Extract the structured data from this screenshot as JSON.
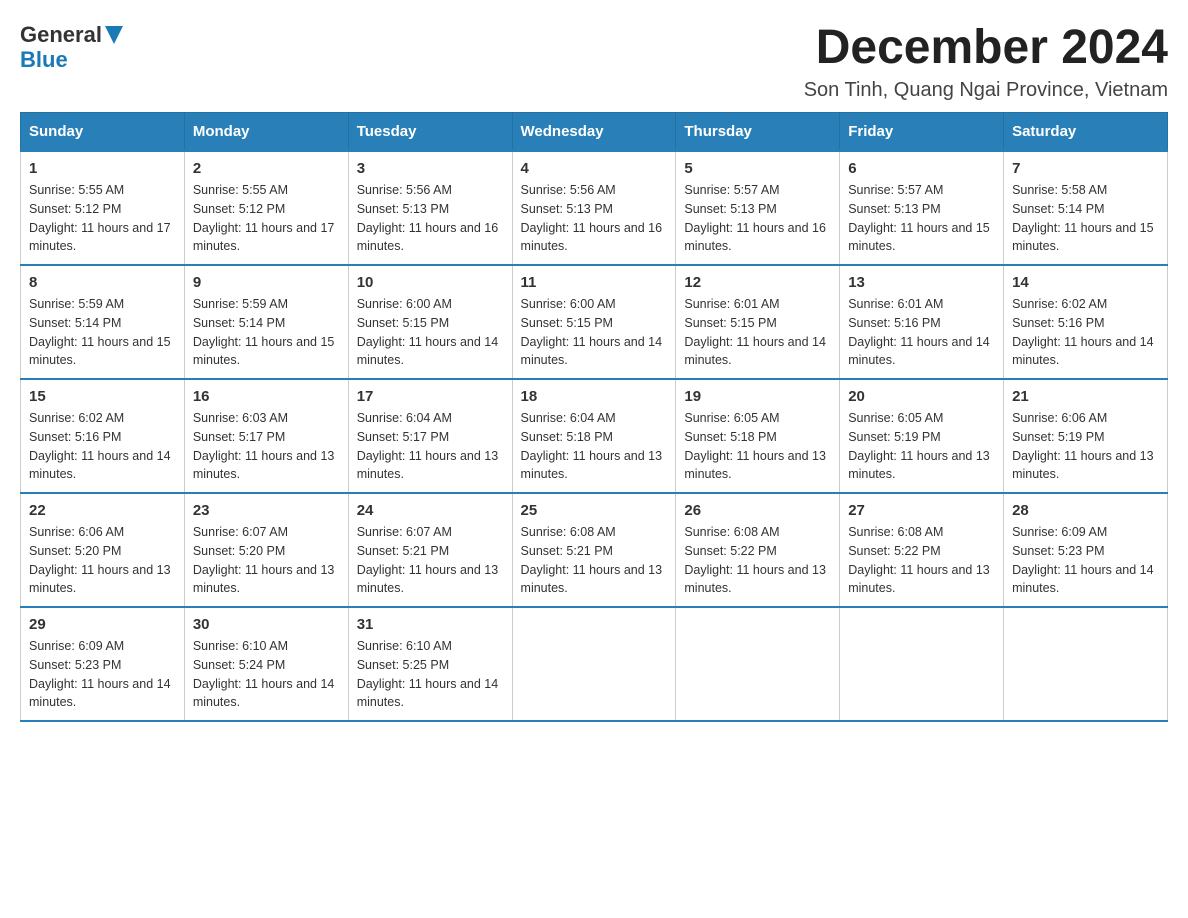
{
  "header": {
    "logo_general": "General",
    "logo_blue": "Blue",
    "month_title": "December 2024",
    "location": "Son Tinh, Quang Ngai Province, Vietnam"
  },
  "days_of_week": [
    "Sunday",
    "Monday",
    "Tuesday",
    "Wednesday",
    "Thursday",
    "Friday",
    "Saturday"
  ],
  "weeks": [
    [
      {
        "day": "1",
        "sunrise": "5:55 AM",
        "sunset": "5:12 PM",
        "daylight": "11 hours and 17 minutes."
      },
      {
        "day": "2",
        "sunrise": "5:55 AM",
        "sunset": "5:12 PM",
        "daylight": "11 hours and 17 minutes."
      },
      {
        "day": "3",
        "sunrise": "5:56 AM",
        "sunset": "5:13 PM",
        "daylight": "11 hours and 16 minutes."
      },
      {
        "day": "4",
        "sunrise": "5:56 AM",
        "sunset": "5:13 PM",
        "daylight": "11 hours and 16 minutes."
      },
      {
        "day": "5",
        "sunrise": "5:57 AM",
        "sunset": "5:13 PM",
        "daylight": "11 hours and 16 minutes."
      },
      {
        "day": "6",
        "sunrise": "5:57 AM",
        "sunset": "5:13 PM",
        "daylight": "11 hours and 15 minutes."
      },
      {
        "day": "7",
        "sunrise": "5:58 AM",
        "sunset": "5:14 PM",
        "daylight": "11 hours and 15 minutes."
      }
    ],
    [
      {
        "day": "8",
        "sunrise": "5:59 AM",
        "sunset": "5:14 PM",
        "daylight": "11 hours and 15 minutes."
      },
      {
        "day": "9",
        "sunrise": "5:59 AM",
        "sunset": "5:14 PM",
        "daylight": "11 hours and 15 minutes."
      },
      {
        "day": "10",
        "sunrise": "6:00 AM",
        "sunset": "5:15 PM",
        "daylight": "11 hours and 14 minutes."
      },
      {
        "day": "11",
        "sunrise": "6:00 AM",
        "sunset": "5:15 PM",
        "daylight": "11 hours and 14 minutes."
      },
      {
        "day": "12",
        "sunrise": "6:01 AM",
        "sunset": "5:15 PM",
        "daylight": "11 hours and 14 minutes."
      },
      {
        "day": "13",
        "sunrise": "6:01 AM",
        "sunset": "5:16 PM",
        "daylight": "11 hours and 14 minutes."
      },
      {
        "day": "14",
        "sunrise": "6:02 AM",
        "sunset": "5:16 PM",
        "daylight": "11 hours and 14 minutes."
      }
    ],
    [
      {
        "day": "15",
        "sunrise": "6:02 AM",
        "sunset": "5:16 PM",
        "daylight": "11 hours and 14 minutes."
      },
      {
        "day": "16",
        "sunrise": "6:03 AM",
        "sunset": "5:17 PM",
        "daylight": "11 hours and 13 minutes."
      },
      {
        "day": "17",
        "sunrise": "6:04 AM",
        "sunset": "5:17 PM",
        "daylight": "11 hours and 13 minutes."
      },
      {
        "day": "18",
        "sunrise": "6:04 AM",
        "sunset": "5:18 PM",
        "daylight": "11 hours and 13 minutes."
      },
      {
        "day": "19",
        "sunrise": "6:05 AM",
        "sunset": "5:18 PM",
        "daylight": "11 hours and 13 minutes."
      },
      {
        "day": "20",
        "sunrise": "6:05 AM",
        "sunset": "5:19 PM",
        "daylight": "11 hours and 13 minutes."
      },
      {
        "day": "21",
        "sunrise": "6:06 AM",
        "sunset": "5:19 PM",
        "daylight": "11 hours and 13 minutes."
      }
    ],
    [
      {
        "day": "22",
        "sunrise": "6:06 AM",
        "sunset": "5:20 PM",
        "daylight": "11 hours and 13 minutes."
      },
      {
        "day": "23",
        "sunrise": "6:07 AM",
        "sunset": "5:20 PM",
        "daylight": "11 hours and 13 minutes."
      },
      {
        "day": "24",
        "sunrise": "6:07 AM",
        "sunset": "5:21 PM",
        "daylight": "11 hours and 13 minutes."
      },
      {
        "day": "25",
        "sunrise": "6:08 AM",
        "sunset": "5:21 PM",
        "daylight": "11 hours and 13 minutes."
      },
      {
        "day": "26",
        "sunrise": "6:08 AM",
        "sunset": "5:22 PM",
        "daylight": "11 hours and 13 minutes."
      },
      {
        "day": "27",
        "sunrise": "6:08 AM",
        "sunset": "5:22 PM",
        "daylight": "11 hours and 13 minutes."
      },
      {
        "day": "28",
        "sunrise": "6:09 AM",
        "sunset": "5:23 PM",
        "daylight": "11 hours and 14 minutes."
      }
    ],
    [
      {
        "day": "29",
        "sunrise": "6:09 AM",
        "sunset": "5:23 PM",
        "daylight": "11 hours and 14 minutes."
      },
      {
        "day": "30",
        "sunrise": "6:10 AM",
        "sunset": "5:24 PM",
        "daylight": "11 hours and 14 minutes."
      },
      {
        "day": "31",
        "sunrise": "6:10 AM",
        "sunset": "5:25 PM",
        "daylight": "11 hours and 14 minutes."
      },
      null,
      null,
      null,
      null
    ]
  ]
}
